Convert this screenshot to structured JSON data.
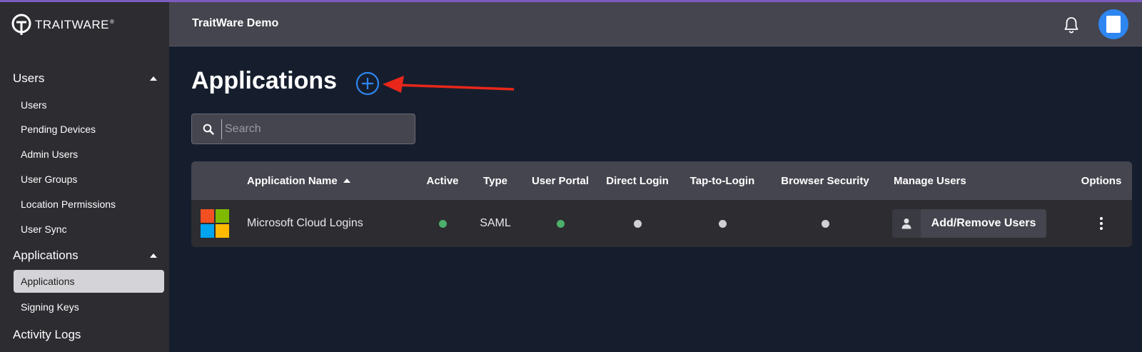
{
  "colors": {
    "sidebar_bg": "#2c2c31",
    "header_bg": "#45454f",
    "main_bg": "#161e2e",
    "accent": "#2e86f0",
    "annotation_arrow": "#e8271a",
    "status_active": "#4caf6a",
    "status_inactive": "#d0d0d4"
  },
  "brand": {
    "name": "TRAITWARE",
    "reg": "®"
  },
  "sidebar": {
    "sections": [
      {
        "label": "Users",
        "expanded": true,
        "items": [
          {
            "label": "Users",
            "active": false
          },
          {
            "label": "Pending Devices",
            "active": false
          },
          {
            "label": "Admin Users",
            "active": false
          },
          {
            "label": "User Groups",
            "active": false
          },
          {
            "label": "Location Permissions",
            "active": false
          },
          {
            "label": "User Sync",
            "active": false
          }
        ]
      },
      {
        "label": "Applications",
        "expanded": true,
        "items": [
          {
            "label": "Applications",
            "active": true
          },
          {
            "label": "Signing Keys",
            "active": false
          }
        ]
      },
      {
        "label": "Activity Logs",
        "expanded": false,
        "items": []
      }
    ]
  },
  "header": {
    "title": "TraitWare Demo",
    "bell_icon": "bell-icon",
    "avatar_icon": "user-avatar"
  },
  "main": {
    "title": "Applications",
    "add_icon": "plus-circle-icon",
    "search": {
      "placeholder": "Search",
      "value": ""
    },
    "table": {
      "columns": [
        {
          "label": "",
          "key": "logo"
        },
        {
          "label": "Application Name",
          "key": "name",
          "sorted": "asc"
        },
        {
          "label": "Active",
          "key": "active"
        },
        {
          "label": "Type",
          "key": "type"
        },
        {
          "label": "User Portal",
          "key": "user_portal"
        },
        {
          "label": "Direct Login",
          "key": "direct_login"
        },
        {
          "label": "Tap-to-Login",
          "key": "tap_to_login"
        },
        {
          "label": "Browser Security",
          "key": "browser_security"
        },
        {
          "label": "Manage Users",
          "key": "manage_users"
        },
        {
          "label": "Options",
          "key": "options"
        }
      ],
      "rows": [
        {
          "logo": "microsoft-logo",
          "name": "Microsoft Cloud Logins",
          "active": true,
          "type": "SAML",
          "user_portal": true,
          "direct_login": false,
          "tap_to_login": false,
          "browser_security": false,
          "manage_users_label": "Add/Remove Users"
        }
      ]
    }
  }
}
